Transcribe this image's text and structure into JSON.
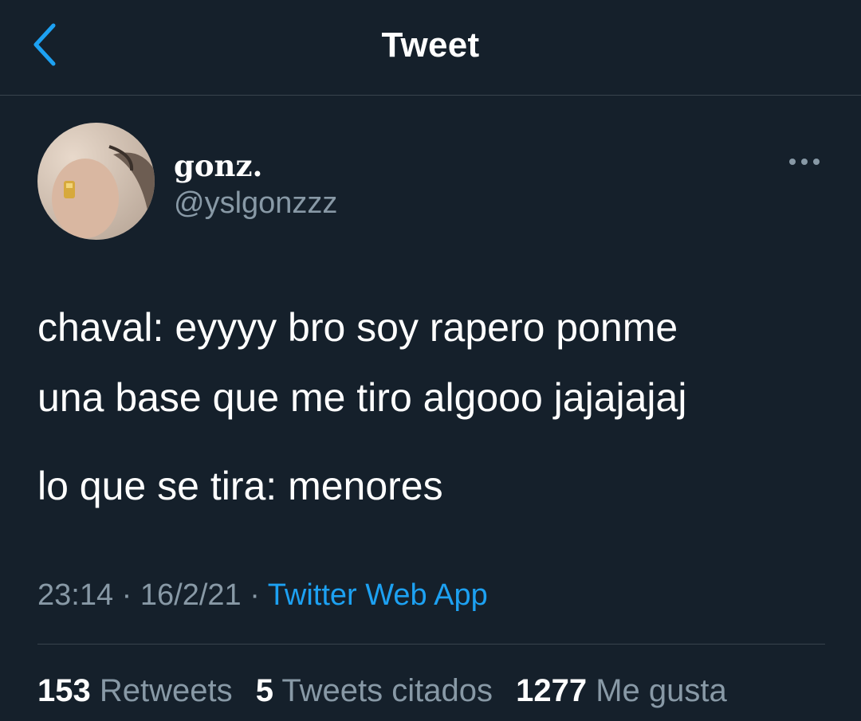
{
  "header": {
    "title": "Tweet",
    "back_icon": "chevron-left-icon"
  },
  "author": {
    "display_name": "gonz.",
    "handle": "@yslgonzzz"
  },
  "tweet": {
    "lines": [
      "chaval: eyyyy bro soy rapero ponme",
      "una base que me tiro algooo jajajajaj",
      "lo que se tira: menores"
    ],
    "time": "23:14",
    "separator": " · ",
    "date": "16/2/21",
    "source": "Twitter Web App"
  },
  "stats": {
    "retweets_count": "153",
    "retweets_label": "Retweets",
    "quotes_count": "5",
    "quotes_label": "Tweets citados",
    "likes_count": "1277",
    "likes_label": "Me gusta"
  },
  "colors": {
    "background": "#15202b",
    "accent": "#1da1f2",
    "secondary_text": "#8899a6",
    "divider": "#38444d"
  }
}
